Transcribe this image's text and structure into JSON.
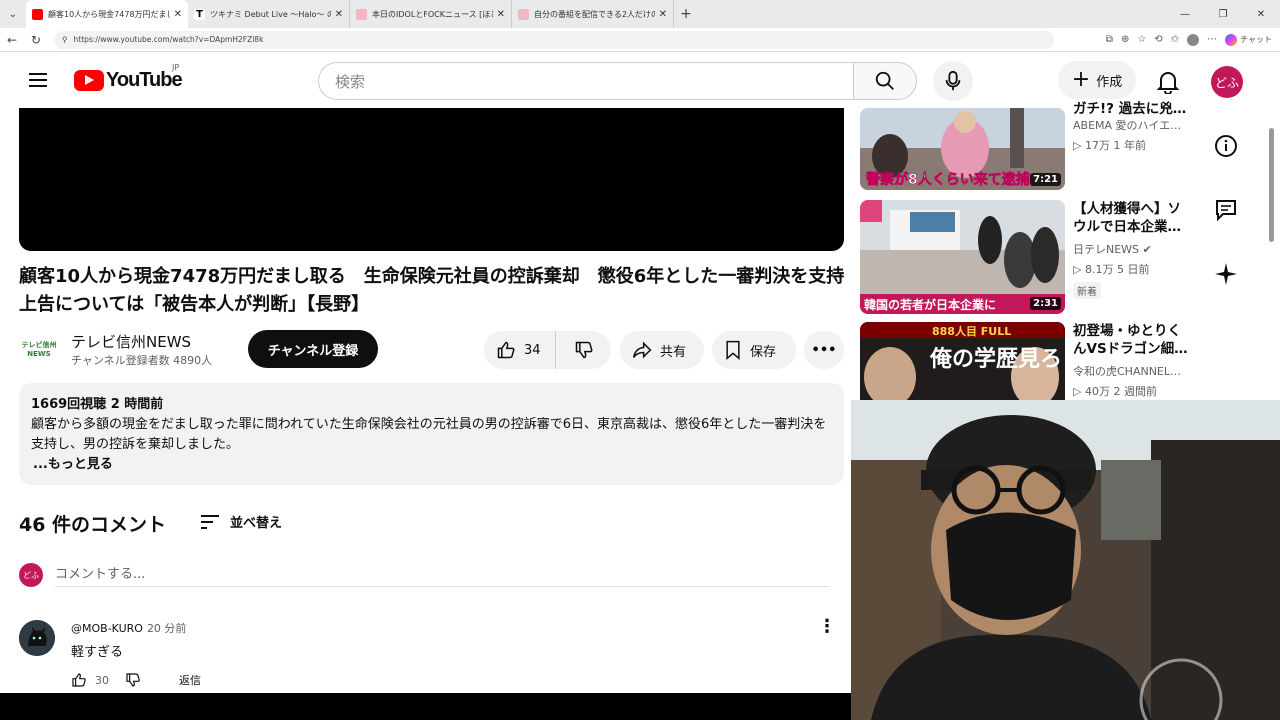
{
  "browser": {
    "tabs": [
      {
        "title": "顧客10人から現金7478万円だまし取",
        "active": true
      },
      {
        "title": "ツキナミ Debut Live 〜Halo〜 の子ケ",
        "active": false
      },
      {
        "title": "本日のIDOLとFOCKニュース [ほどぶ",
        "active": false
      },
      {
        "title": "自分の番組を配信できる2人だけの",
        "active": false
      }
    ],
    "url": "https://www.youtube.com/watch?v=DApmH2FZl8k",
    "chat_label": "チャット",
    "win_min": "—",
    "win_max": "❐",
    "win_close": "✕"
  },
  "header": {
    "logo_text": "YouTube",
    "logo_region": "JP",
    "search_placeholder": "検索",
    "create_label": "作成",
    "avatar_label": "どふ"
  },
  "video": {
    "title": "顧客10人から現金7478万円だまし取る　生命保険元社員の控訴棄却　懲役6年とした一審判決を支持　上告については「被告本人が判断」【長野】",
    "channel_name": "テレビ信州NEWS",
    "channel_logo_line1": "テレビ信州",
    "channel_logo_line2": "NEWS",
    "subscribers": "チャンネル登録者数 4890人",
    "subscribe_label": "チャンネル登録",
    "likes": "34",
    "share_label": "共有",
    "save_label": "保存",
    "more_label": "•••"
  },
  "description": {
    "stats": "1669回視聴  2 時間前",
    "text": "顧客から多額の現金をだまし取った罪に問われていた生命保険会社の元社員の男の控訴審で6日、東京高裁は、懲役6年とした一審判決を支持し、男の控訴を棄却しました。",
    "more": "...もっと見る"
  },
  "comments": {
    "count_label": "46 件のコメント",
    "sort_label": "並べ替え",
    "input_placeholder": "コメントする...",
    "my_avatar": "どふ",
    "items": [
      {
        "author": "@MOB-KURO",
        "time": "20 分前",
        "text": "軽すぎる",
        "likes": "30",
        "reply_label": "返信"
      }
    ]
  },
  "recommendations": [
    {
      "title": "ガチ!? 過去に兇…",
      "channel": "ABEMA 愛のハイエ…",
      "meta": "▷ 17万  1 年前",
      "duration": "7:21",
      "thumb_caption": "警察が8人くらい来て逮捕",
      "badge": ""
    },
    {
      "title": "【人材獲得へ】ソウルで日本企業…",
      "channel": "日テレNEWS ✔",
      "meta": "▷ 8.1万  5 日前",
      "duration": "2:31",
      "thumb_caption": "韓国の若者が日本企業に",
      "badge": "新着"
    },
    {
      "title": "初登場・ゆとりくんVSドラゴン細…",
      "channel": "令和の虎CHANNEL…",
      "meta": "▷ 40万  2 週間前",
      "duration": "",
      "thumb_caption": "俺の学歴見ろ!",
      "thumb_banner": "888人目 FULL",
      "badge": ""
    }
  ]
}
